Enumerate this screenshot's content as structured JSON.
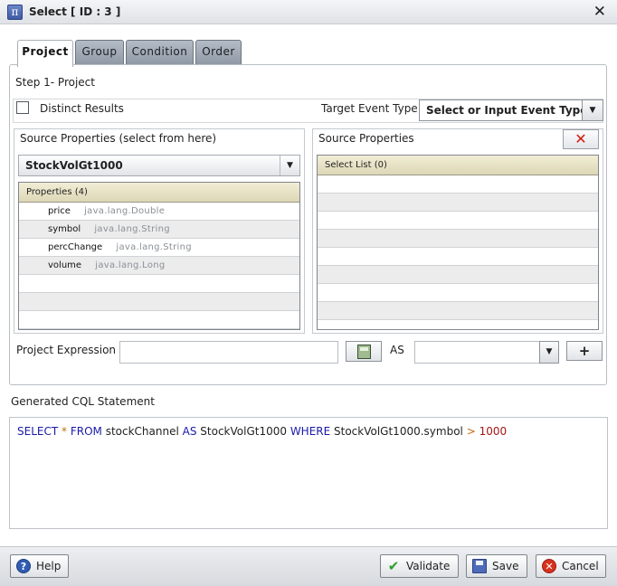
{
  "window": {
    "title": "Select [ ID : 3 ]",
    "app_icon_glyph": "π",
    "close_glyph": "✕"
  },
  "tabs": [
    {
      "label": "Project",
      "active": true
    },
    {
      "label": "Group",
      "active": false
    },
    {
      "label": "Condition",
      "active": false
    },
    {
      "label": "Order",
      "active": false
    }
  ],
  "project": {
    "step_label": "Step 1- Project",
    "distinct_label": "Distinct Results",
    "distinct_checked": false,
    "target_label": "Target Event Type",
    "target_value": "Select or Input Event Type",
    "source_left_title": "Source Properties (select from here)",
    "source_selected": "StockVolGt1000",
    "properties_header": "Properties (4)",
    "properties": [
      {
        "name": "price",
        "type": "java.lang.Double"
      },
      {
        "name": "symbol",
        "type": "java.lang.String"
      },
      {
        "name": "percChange",
        "type": "java.lang.String"
      },
      {
        "name": "volume",
        "type": "java.lang.Long"
      }
    ],
    "source_right_title": "Source Properties",
    "select_list_header": "Select List (0)",
    "expression_label": "Project Expression",
    "expression_value": "",
    "as_label": "AS",
    "as_value": "",
    "plus_label": "+"
  },
  "cql": {
    "label": "Generated CQL Statement",
    "tokens": [
      {
        "text": "SELECT",
        "kind": "kw"
      },
      {
        "text": " ",
        "kind": "plain"
      },
      {
        "text": "*",
        "kind": "op"
      },
      {
        "text": " ",
        "kind": "plain"
      },
      {
        "text": "FROM",
        "kind": "kw"
      },
      {
        "text": " stockChannel ",
        "kind": "plain"
      },
      {
        "text": "AS",
        "kind": "kw"
      },
      {
        "text": " StockVolGt1000 ",
        "kind": "plain"
      },
      {
        "text": "WHERE",
        "kind": "kw"
      },
      {
        "text": " StockVolGt1000.symbol ",
        "kind": "plain"
      },
      {
        "text": ">",
        "kind": "op"
      },
      {
        "text": " ",
        "kind": "plain"
      },
      {
        "text": "1000",
        "kind": "num"
      }
    ]
  },
  "footer": {
    "help_label": "Help",
    "validate_label": "Validate",
    "save_label": "Save",
    "cancel_label": "Cancel"
  },
  "icons": {
    "help": "?",
    "validate": "✔",
    "cancel": "✕",
    "delete": "✕",
    "dropdown": "▼"
  }
}
